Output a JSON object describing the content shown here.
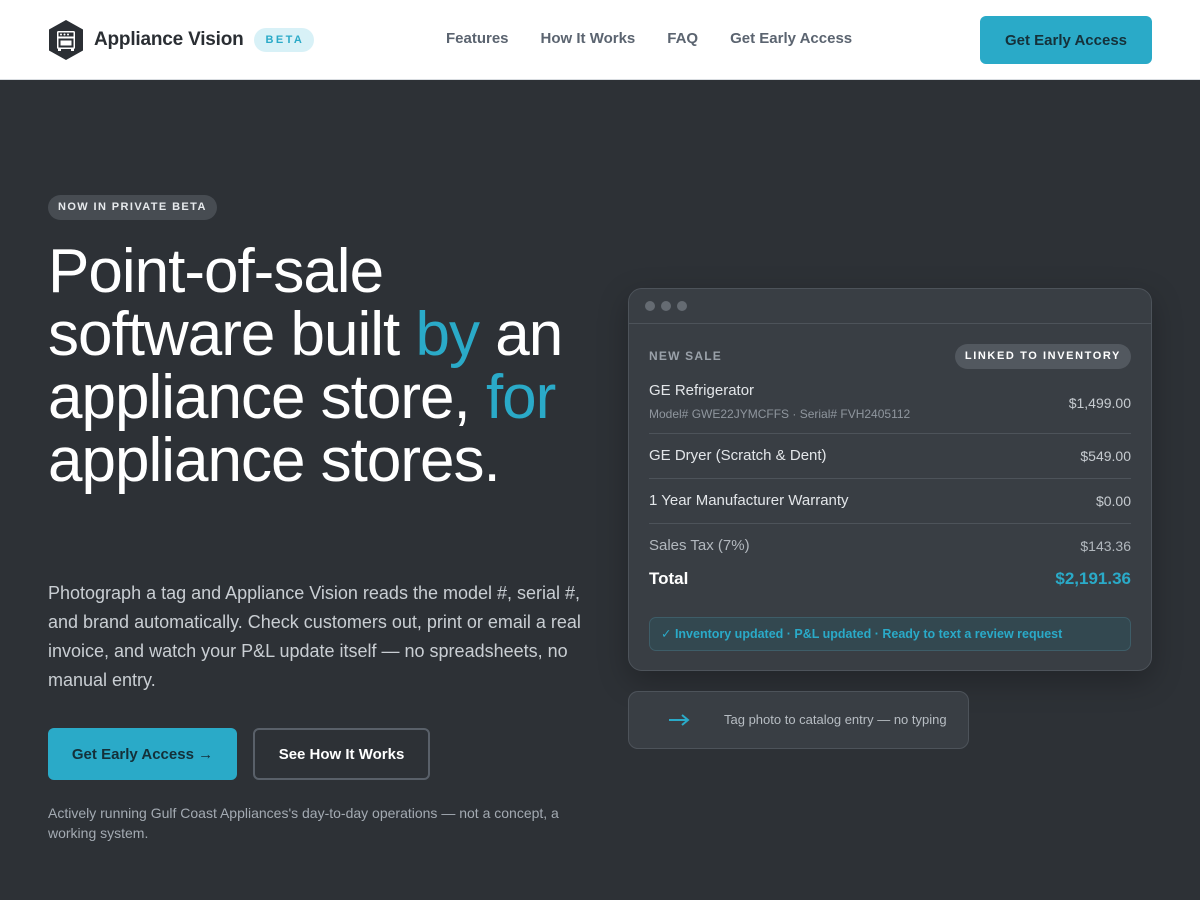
{
  "header": {
    "brand": "Appliance Vision",
    "beta_badge": "BETA",
    "nav": [
      "Features",
      "How It Works",
      "FAQ",
      "Get Early Access"
    ],
    "cta": "Get Early Access"
  },
  "hero": {
    "eyebrow": "NOW IN PRIVATE BETA",
    "headline": {
      "part1": "Point-of-sale software built ",
      "accent1": "by",
      "part2": " an appliance store, ",
      "accent2": "for",
      "part3": " appliance stores."
    },
    "description": "Photograph a tag and Appliance Vision reads the model #, serial #, and brand automatically. Check customers out, print or email a real invoice, and watch your P&L update itself — no spreadsheets, no manual entry.",
    "primary_cta": "Get Early Access →",
    "secondary_cta": "See How It Works",
    "footnote": "Actively running Gulf Coast Appliances's day-to-day operations — not a concept, a working system."
  },
  "sale_card": {
    "label": "NEW SALE",
    "badge": "LINKED TO INVENTORY",
    "items": [
      {
        "name": "GE Refrigerator",
        "meta": "Model# GWE22JYMCFFS · Serial# FVH2405112",
        "price": "$1,499.00"
      },
      {
        "name": "GE Dryer (Scratch & Dent)",
        "price": "$549.00"
      },
      {
        "name": "1 Year Manufacturer Warranty",
        "price": "$0.00"
      },
      {
        "name": "Sales Tax (7%)",
        "price": "$143.36"
      }
    ],
    "total_label": "Total",
    "total_value": "$2,191.36",
    "status": "✓ Inventory updated · P&L updated · Ready to text a review request"
  },
  "tag_card": {
    "text": "Tag photo to catalog entry — no typing"
  },
  "colors": {
    "accent": "#2aaac8",
    "background": "#2d3136",
    "card": "#393e44"
  },
  "icons": [
    "appliance-logo-icon",
    "window-dots-icon",
    "arrow-right-icon"
  ]
}
